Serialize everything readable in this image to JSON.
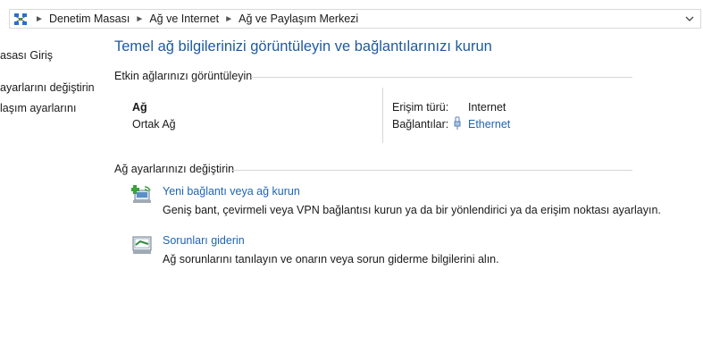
{
  "breadcrumb": {
    "items": [
      "Denetim Masası",
      "Ağ ve Internet",
      "Ağ ve Paylaşım Merkezi"
    ]
  },
  "sidebar": {
    "items": [
      {
        "label": "asası Giriş"
      },
      {
        "label": "ayarlarını değiştirin"
      },
      {
        "label": "laşım ayarlarını"
      }
    ]
  },
  "main": {
    "title": "Temel ağ bilgilerinizi görüntüleyin ve bağlantılarınızı kurun",
    "active_networks": {
      "heading": "Etkin ağlarınızı görüntüleyin",
      "network_name": "Ağ",
      "network_type": "Ortak Ağ",
      "access_type_label": "Erişim türü:",
      "access_type_value": "Internet",
      "connections_label": "Bağlantılar:",
      "connection_name": "Ethernet"
    },
    "change_settings": {
      "heading": "Ağ ayarlarınızı değiştirin",
      "items": [
        {
          "title": "Yeni bağlantı veya ağ kurun",
          "description": "Geniş bant, çevirmeli veya VPN bağlantısı kurun ya da bir yönlendirici ya da erişim noktası ayarlayın.",
          "icon": "new-connection-icon"
        },
        {
          "title": "Sorunları giderin",
          "description": "Ağ sorunlarını tanılayın ve onarın veya sorun giderme bilgilerini alın.",
          "icon": "troubleshoot-icon"
        }
      ]
    }
  },
  "colors": {
    "link": "#1e64b4",
    "title": "#1e5aa0",
    "rule": "#d6d6d6"
  }
}
